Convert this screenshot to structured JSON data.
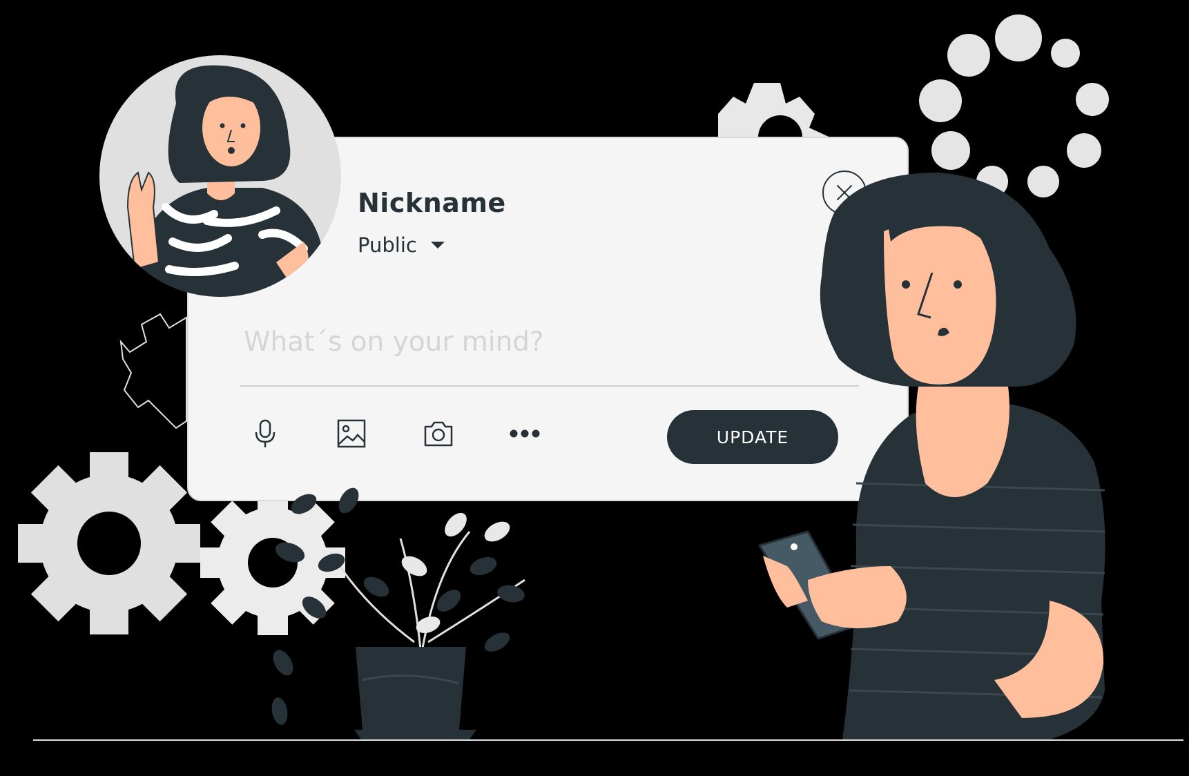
{
  "post_card": {
    "nickname": "Nickname",
    "privacy": "Public",
    "input_placeholder": "What´s on your mind?",
    "input_value": "",
    "update_label": "UPDATE",
    "tools": [
      "microphone-icon",
      "image-icon",
      "camera-icon",
      "more-icon"
    ]
  },
  "colors": {
    "ink": "#263238",
    "skin": "#ffbf9d",
    "card": "#f5f5f5",
    "light_gray": "#e0e0e0"
  }
}
